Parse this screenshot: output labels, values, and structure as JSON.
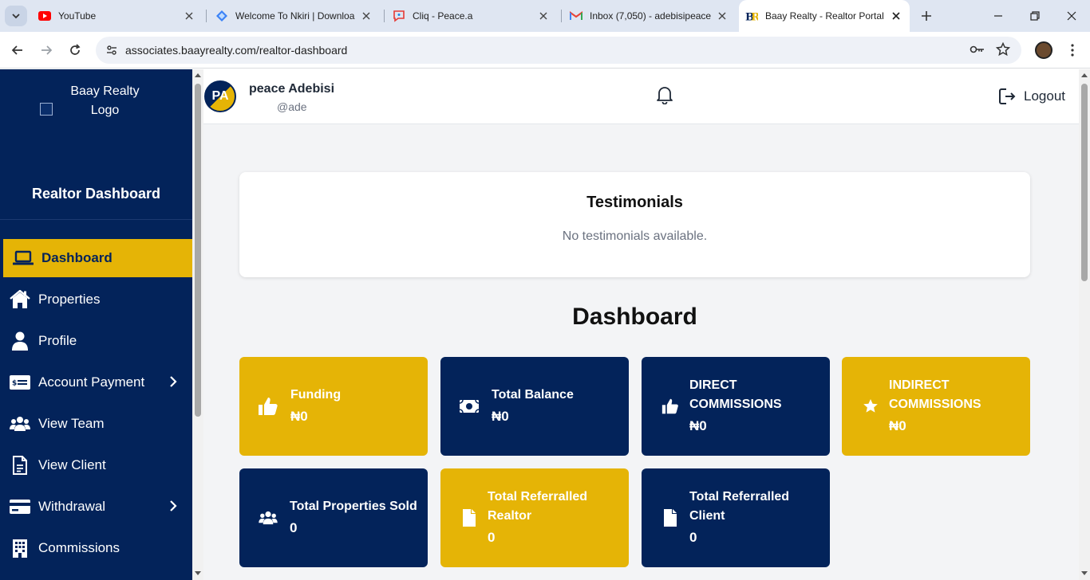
{
  "browser": {
    "tabs": [
      {
        "title": "YouTube",
        "icon": "youtube-icon"
      },
      {
        "title": "Welcome To Nkiri | Downloa",
        "icon": "nkiri-icon"
      },
      {
        "title": "Cliq - Peace.a",
        "icon": "cliq-icon"
      },
      {
        "title": "Inbox (7,050) - adebisipeace",
        "icon": "gmail-icon"
      },
      {
        "title": "Baay Realty - Realtor Portal",
        "icon": "baay-realty-icon",
        "active": true
      }
    ],
    "url": "associates.baayrealty.com/realtor-dashboard"
  },
  "sidebar": {
    "logo_alt": "Baay Realty Logo",
    "title": "Realtor Dashboard",
    "items": [
      {
        "label": "Dashboard",
        "icon": "laptop-icon"
      },
      {
        "label": "Properties",
        "icon": "home-icon"
      },
      {
        "label": "Profile",
        "icon": "user-icon"
      },
      {
        "label": "Account Payment",
        "icon": "payment-card-icon"
      },
      {
        "label": "View Team",
        "icon": "users-icon"
      },
      {
        "label": "View Client",
        "icon": "document-icon"
      },
      {
        "label": "Withdrawal",
        "icon": "credit-card-icon"
      },
      {
        "label": "Commissions",
        "icon": "building-icon"
      }
    ]
  },
  "topbar": {
    "avatar_initials": "PA",
    "user_name": "peace Adebisi",
    "user_handle": "@ade",
    "logout_label": "Logout"
  },
  "testimonials": {
    "title": "Testimonials",
    "empty_text": "No testimonials available."
  },
  "dashboard": {
    "title": "Dashboard",
    "cards": [
      {
        "label": "Funding",
        "value": "₦0",
        "icon": "thumbs-up-icon",
        "color": "#e5b406"
      },
      {
        "label": "Total Balance",
        "value": "₦0",
        "icon": "money-bill-icon",
        "color": "#03235a"
      },
      {
        "label": "DIRECT COMMISSIONS",
        "value": "₦0",
        "icon": "thumbs-up-icon",
        "color": "#03235a"
      },
      {
        "label": "INDIRECT COMMISSIONS",
        "value": "₦0",
        "icon": "star-icon",
        "color": "#e5b406"
      },
      {
        "label": "Total Properties Sold",
        "value": "0",
        "icon": "users-icon",
        "color": "#03235a"
      },
      {
        "label": "Total Referralled Realtor",
        "value": "0",
        "icon": "file-icon",
        "color": "#e5b406"
      },
      {
        "label": "Total Referralled Client",
        "value": "0",
        "icon": "file-icon",
        "color": "#03235a"
      }
    ]
  },
  "colors": {
    "navy": "#03235a",
    "gold": "#e5b406",
    "page_bg": "#f3f4f6"
  }
}
